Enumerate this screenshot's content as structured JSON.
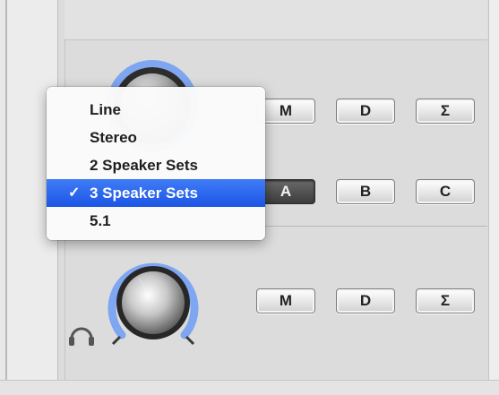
{
  "output_menu": {
    "items": [
      {
        "label": "Line",
        "checked": false
      },
      {
        "label": "Stereo",
        "checked": false
      },
      {
        "label": "2 Speaker Sets",
        "checked": false
      },
      {
        "label": "3 Speaker Sets",
        "checked": true
      },
      {
        "label": "5.1",
        "checked": false
      }
    ],
    "check_mark": "✓"
  },
  "main_output": {
    "buttons": {
      "mute": "M",
      "dim": "D",
      "sum": "Σ"
    },
    "speaker_sets": {
      "a": "A",
      "b": "B",
      "c": "C",
      "selected": "A"
    }
  },
  "headphone_output": {
    "icon": "headphones-icon",
    "buttons": {
      "mute": "M",
      "dim": "D",
      "sum": "Σ"
    }
  },
  "colors": {
    "selection": "#2a63ee",
    "knob_ring": "#6f9cf0",
    "active_button": "#4a4a4a"
  }
}
